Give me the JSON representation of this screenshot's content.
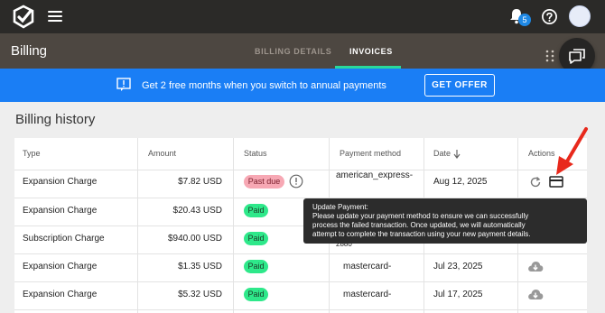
{
  "topbar": {
    "logo_icon": "checkmark-logo-icon",
    "menu_icon": "hamburger-icon",
    "notifications_icon": "bell-icon",
    "notifications_count": "5",
    "help_icon": "help-circle-icon",
    "avatar_icon": "user-avatar"
  },
  "header": {
    "title": "Billing",
    "tabs": [
      {
        "label": "BILLING DETAILS",
        "active": false
      },
      {
        "label": "INVOICES",
        "active": true
      }
    ],
    "accent": "#29d89b"
  },
  "promo": {
    "text": "Get 2 free months when you switch to annual payments",
    "button_label": "GET OFFER",
    "color": "#1a7ef5"
  },
  "history": {
    "title": "Billing history",
    "columns": [
      "Type",
      "Amount",
      "Status",
      "Payment method",
      "Date",
      "Actions"
    ],
    "rows": [
      {
        "type": "Expansion Charge",
        "amount": "$7.82 USD",
        "status": "Past due",
        "method": "american_express-",
        "date": "Aug 12, 2025",
        "actions": [
          "retry-icon",
          "credit-card-icon"
        ]
      },
      {
        "type": "Expansion Charge",
        "amount": "$20.43 USD",
        "status": "Paid",
        "method": "",
        "date": "",
        "actions": []
      },
      {
        "type": "Subscription Charge",
        "amount": "$940.00 USD",
        "status": "Paid",
        "method": "2880",
        "date": "",
        "actions": []
      },
      {
        "type": "Expansion Charge",
        "amount": "$1.35 USD",
        "status": "Paid",
        "method": "mastercard-",
        "date": "Jul 23, 2025",
        "actions": [
          "download-icon"
        ]
      },
      {
        "type": "Expansion Charge",
        "amount": "$5.32 USD",
        "status": "Paid",
        "method": "mastercard-",
        "date": "Jul 17, 2025",
        "actions": [
          "download-icon"
        ]
      }
    ]
  },
  "tooltip": {
    "title": "Update Payment:",
    "lines": [
      "Please update your payment method to ensure we can successfully",
      "process the failed transaction. Once updated, we will automatically",
      "attempt to complete the transaction using your new payment details."
    ]
  }
}
